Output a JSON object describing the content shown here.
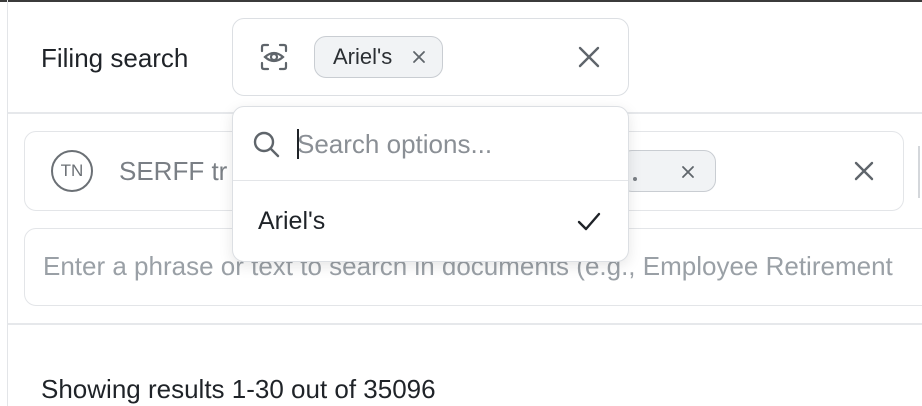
{
  "filing_search": {
    "label": "Filing search",
    "icon": "eye-scan-icon",
    "selected_chip": "Ariel's"
  },
  "dropdown": {
    "search_placeholder": "Search options...",
    "options": [
      {
        "label": "Ariel's",
        "selected": true
      }
    ]
  },
  "tracking_filter": {
    "badge": "TN",
    "text": "SERFF tr"
  },
  "phrase_search": {
    "placeholder": "Enter a phrase or text to search in documents (e.g., Employee Retirement"
  },
  "results": {
    "summary": "Showing results 1-30 out of 35096"
  },
  "colors": {
    "chip_bg": "#f1f3f5",
    "border": "#dcdfe3",
    "placeholder": "#9aa0a6"
  }
}
